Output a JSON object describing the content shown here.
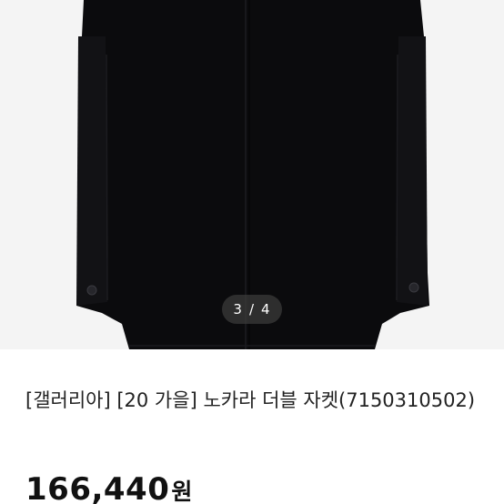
{
  "gallery": {
    "current": "3",
    "separator": "/",
    "total": "4",
    "image_icon": "black-double-jacket-photo",
    "colors": {
      "background": "#f4f4f4",
      "jacket": "#0b0b0d",
      "pager_bg": "rgba(60,60,60,0.72)"
    }
  },
  "product": {
    "title": "[갤러리아] [20 가을] 노카라 더블 자켓(7150310502)",
    "price": "166,440",
    "currency": "원"
  }
}
